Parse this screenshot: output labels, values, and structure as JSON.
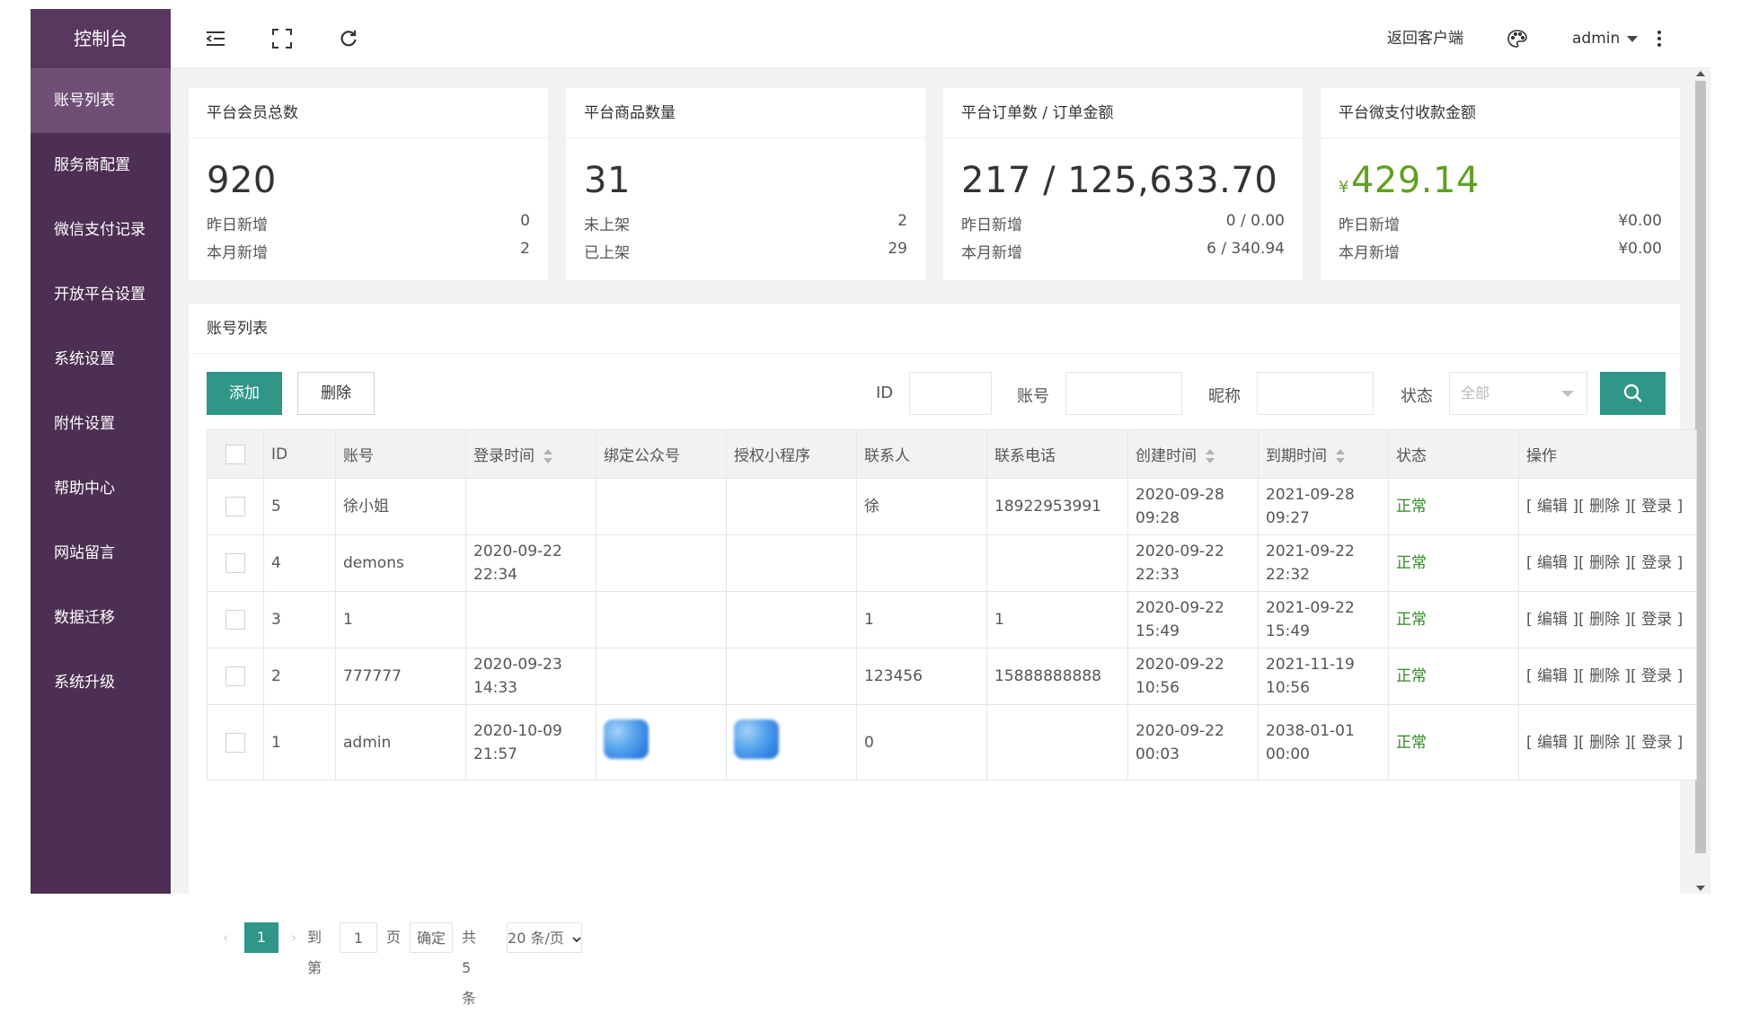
{
  "sidebar": {
    "logo": "控制台",
    "items": [
      {
        "label": "账号列表"
      },
      {
        "label": "服务商配置"
      },
      {
        "label": "微信支付记录"
      },
      {
        "label": "开放平台设置"
      },
      {
        "label": "系统设置"
      },
      {
        "label": "附件设置"
      },
      {
        "label": "帮助中心"
      },
      {
        "label": "网站留言"
      },
      {
        "label": "数据迁移"
      },
      {
        "label": "系统升级"
      }
    ]
  },
  "header": {
    "menu_icon": "menu-fold-icon",
    "fullscreen_icon": "fullscreen-icon",
    "refresh_icon": "refresh-icon",
    "back_client": "返回客户端",
    "theme_icon": "palette-icon",
    "user": "admin",
    "more_icon": "more-vertical-icon"
  },
  "stats": [
    {
      "title": "平台会员总数",
      "value": "920",
      "rows": [
        {
          "label": "昨日新增",
          "value": "0"
        },
        {
          "label": "本月新增",
          "value": "2"
        }
      ]
    },
    {
      "title": "平台商品数量",
      "value": "31",
      "rows": [
        {
          "label": "未上架",
          "value": "2"
        },
        {
          "label": "已上架",
          "value": "29"
        }
      ]
    },
    {
      "title": "平台订单数 / 订单金额",
      "value": "217 / 125,633.70",
      "rows": [
        {
          "label": "昨日新增",
          "value": "0 / 0.00"
        },
        {
          "label": "本月新增",
          "value": "6 / 340.94"
        }
      ]
    },
    {
      "title": "平台微支付收款金额",
      "currency": "¥",
      "value": "429.14",
      "rows": [
        {
          "label": "昨日新增",
          "value": "¥0.00"
        },
        {
          "label": "本月新增",
          "value": "¥0.00"
        }
      ]
    }
  ],
  "accounts": {
    "title": "账号列表",
    "add_label": "添加",
    "delete_label": "删除",
    "filters": {
      "id_label": "ID",
      "account_label": "账号",
      "nickname_label": "昵称",
      "status_label": "状态",
      "status_value": "全部"
    },
    "columns": [
      "ID",
      "账号",
      "登录时间",
      "绑定公众号",
      "授权小程序",
      "联系人",
      "联系电话",
      "创建时间",
      "到期时间",
      "状态",
      "操作"
    ],
    "rows": [
      {
        "id": "5",
        "account": "徐小姐",
        "login": "",
        "mp": "",
        "mini": "",
        "contact": "徐",
        "phone": "18922953991",
        "created": "2020-09-28 09:28",
        "expires": "2021-09-28 09:27",
        "status": "正常"
      },
      {
        "id": "4",
        "account": "demons",
        "login": "2020-09-22 22:34",
        "mp": "",
        "mini": "",
        "contact": "",
        "phone": "",
        "created": "2020-09-22 22:33",
        "expires": "2021-09-22 22:32",
        "status": "正常"
      },
      {
        "id": "3",
        "account": "1",
        "login": "",
        "mp": "",
        "mini": "",
        "contact": "1",
        "phone": "1",
        "created": "2020-09-22 15:49",
        "expires": "2021-09-22 15:49",
        "status": "正常"
      },
      {
        "id": "2",
        "account": "777777",
        "login": "2020-09-23 14:33",
        "mp": "",
        "mini": "",
        "contact": "123456",
        "phone": "15888888888",
        "created": "2020-09-22 10:56",
        "expires": "2021-11-19 10:56",
        "status": "正常"
      },
      {
        "id": "1",
        "account": "admin",
        "login": "2020-10-09 21:57",
        "mp": "",
        "mini": "",
        "contact": "0",
        "phone": "",
        "created": "2020-09-22 00:03",
        "expires": "2038-01-01 00:00",
        "status": "正常"
      }
    ],
    "ops": [
      "[ 编辑 ]",
      "[ 删除 ]",
      "[ 登录 ]"
    ],
    "pager": {
      "current": "1",
      "goto_label": "到第",
      "goto_value": "1",
      "page_label": "页",
      "confirm": "确定",
      "total": "共 5 条",
      "per_page": "20 条/页"
    }
  },
  "colors": {
    "sidebar_bg": "#4c2f52",
    "sidebar_active": "#6f4f76",
    "primary": "#2f9688",
    "status_ok": "#2e8b22",
    "money_green": "#5fa023"
  }
}
